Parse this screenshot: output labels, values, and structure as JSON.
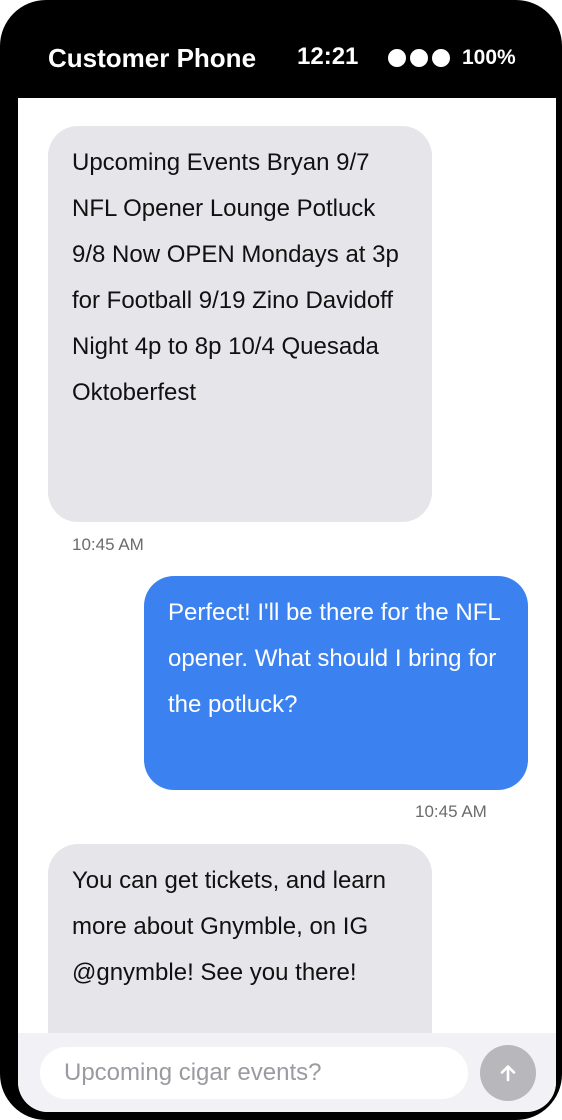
{
  "status_bar": {
    "title": "Customer Phone",
    "time": "12:21",
    "battery": "100%",
    "signal_icon": "signal-dots-icon"
  },
  "messages": [
    {
      "sender": "business",
      "text": "Upcoming Events Bryan 9/7 NFL Opener Lounge Potluck 9/8 Now OPEN Mondays at 3p for Football 9/19 Zino Davidoff Night 4p to 8p 10/4 Quesada Oktoberfest",
      "time": "10:45 AM"
    },
    {
      "sender": "customer",
      "text": "Perfect! I'll be there for the NFL opener. What should I bring for the potluck?",
      "time": "10:45 AM"
    },
    {
      "sender": "business",
      "text": "You can get tickets, and learn more about Gnymble, on IG @gnymble! See you there!",
      "time": ""
    }
  ],
  "composer": {
    "placeholder": "Upcoming cigar events?",
    "value": "",
    "send_icon": "arrow-up-icon"
  },
  "colors": {
    "received_bubble": "#e5e5ea",
    "sent_bubble": "#3b82f0",
    "send_button": "#b8b8bc"
  }
}
